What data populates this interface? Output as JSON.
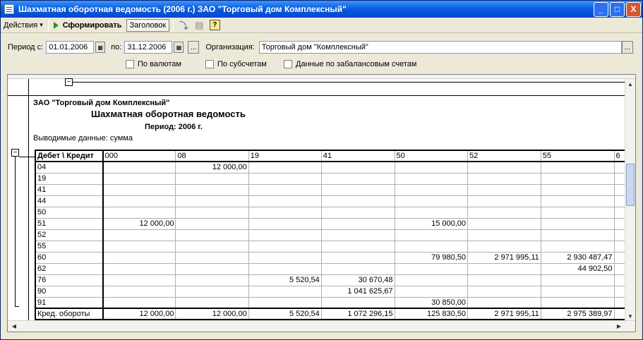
{
  "window": {
    "title": "Шахматная оборотная ведомость (2006 г.) ЗАО \"Торговый дом Комплексный\"",
    "buttons": [
      "_",
      "□",
      "X"
    ]
  },
  "toolbar": {
    "actions_label": "Действия",
    "actions_arrow": "▾",
    "generate_label": "Сформировать",
    "header_label": "Заголовок",
    "help_glyph": "?"
  },
  "filters": {
    "period_from_label": "Период с:",
    "period_from_value": "01.01.2006",
    "period_to_label": "по:",
    "period_to_value": "31.12.2006",
    "ellipsis": "...",
    "org_label": "Организация:",
    "org_value": "Торговый дом \"Комплексный\"",
    "by_currency_label": "По валютам",
    "by_subaccounts_label": "По субсчетам",
    "offbalance_label": "Данные по забалансовым счетам"
  },
  "report": {
    "org_name": "ЗАО \"Торговый дом Комплексный\"",
    "title": "Шахматная оборотная ведомость",
    "period": "Период: 2006 г.",
    "shown_data": "Выводимые данные: сумма",
    "header_corner": "Дебет \\ Кредит",
    "columns": [
      "000",
      "08",
      "19",
      "41",
      "50",
      "52",
      "55",
      "6"
    ],
    "rows": [
      {
        "account": "04",
        "cells": [
          "",
          "12 000,00",
          "",
          "",
          "",
          "",
          "",
          ""
        ]
      },
      {
        "account": "19",
        "cells": [
          "",
          "",
          "",
          "",
          "",
          "",
          "",
          ""
        ]
      },
      {
        "account": "41",
        "cells": [
          "",
          "",
          "",
          "",
          "",
          "",
          "",
          ""
        ]
      },
      {
        "account": "44",
        "cells": [
          "",
          "",
          "",
          "",
          "",
          "",
          "",
          ""
        ]
      },
      {
        "account": "50",
        "cells": [
          "",
          "",
          "",
          "",
          "",
          "",
          "",
          ""
        ]
      },
      {
        "account": "51",
        "cells": [
          "12 000,00",
          "",
          "",
          "",
          "15 000,00",
          "",
          "",
          ""
        ]
      },
      {
        "account": "52",
        "cells": [
          "",
          "",
          "",
          "",
          "",
          "",
          "",
          ""
        ]
      },
      {
        "account": "55",
        "cells": [
          "",
          "",
          "",
          "",
          "",
          "",
          "",
          ""
        ]
      },
      {
        "account": "60",
        "cells": [
          "",
          "",
          "",
          "",
          "79 980,50",
          "2 971 995,11",
          "2 930 487,47",
          ""
        ]
      },
      {
        "account": "62",
        "cells": [
          "",
          "",
          "",
          "",
          "",
          "",
          "44 902,50",
          ""
        ]
      },
      {
        "account": "76",
        "cells": [
          "",
          "",
          "5 520,54",
          "30 670,48",
          "",
          "",
          "",
          ""
        ]
      },
      {
        "account": "90",
        "cells": [
          "",
          "",
          "",
          "1 041 625,67",
          "",
          "",
          "",
          ""
        ]
      },
      {
        "account": "91",
        "cells": [
          "",
          "",
          "",
          "",
          "30 850,00",
          "",
          "",
          ""
        ]
      }
    ],
    "total": {
      "account": "Кред. обороты",
      "cells": [
        "12 000,00",
        "12 000,00",
        "5 520,54",
        "1 072 296,15",
        "125 830,50",
        "2 971 995,11",
        "2 975 389,97",
        ""
      ]
    }
  }
}
